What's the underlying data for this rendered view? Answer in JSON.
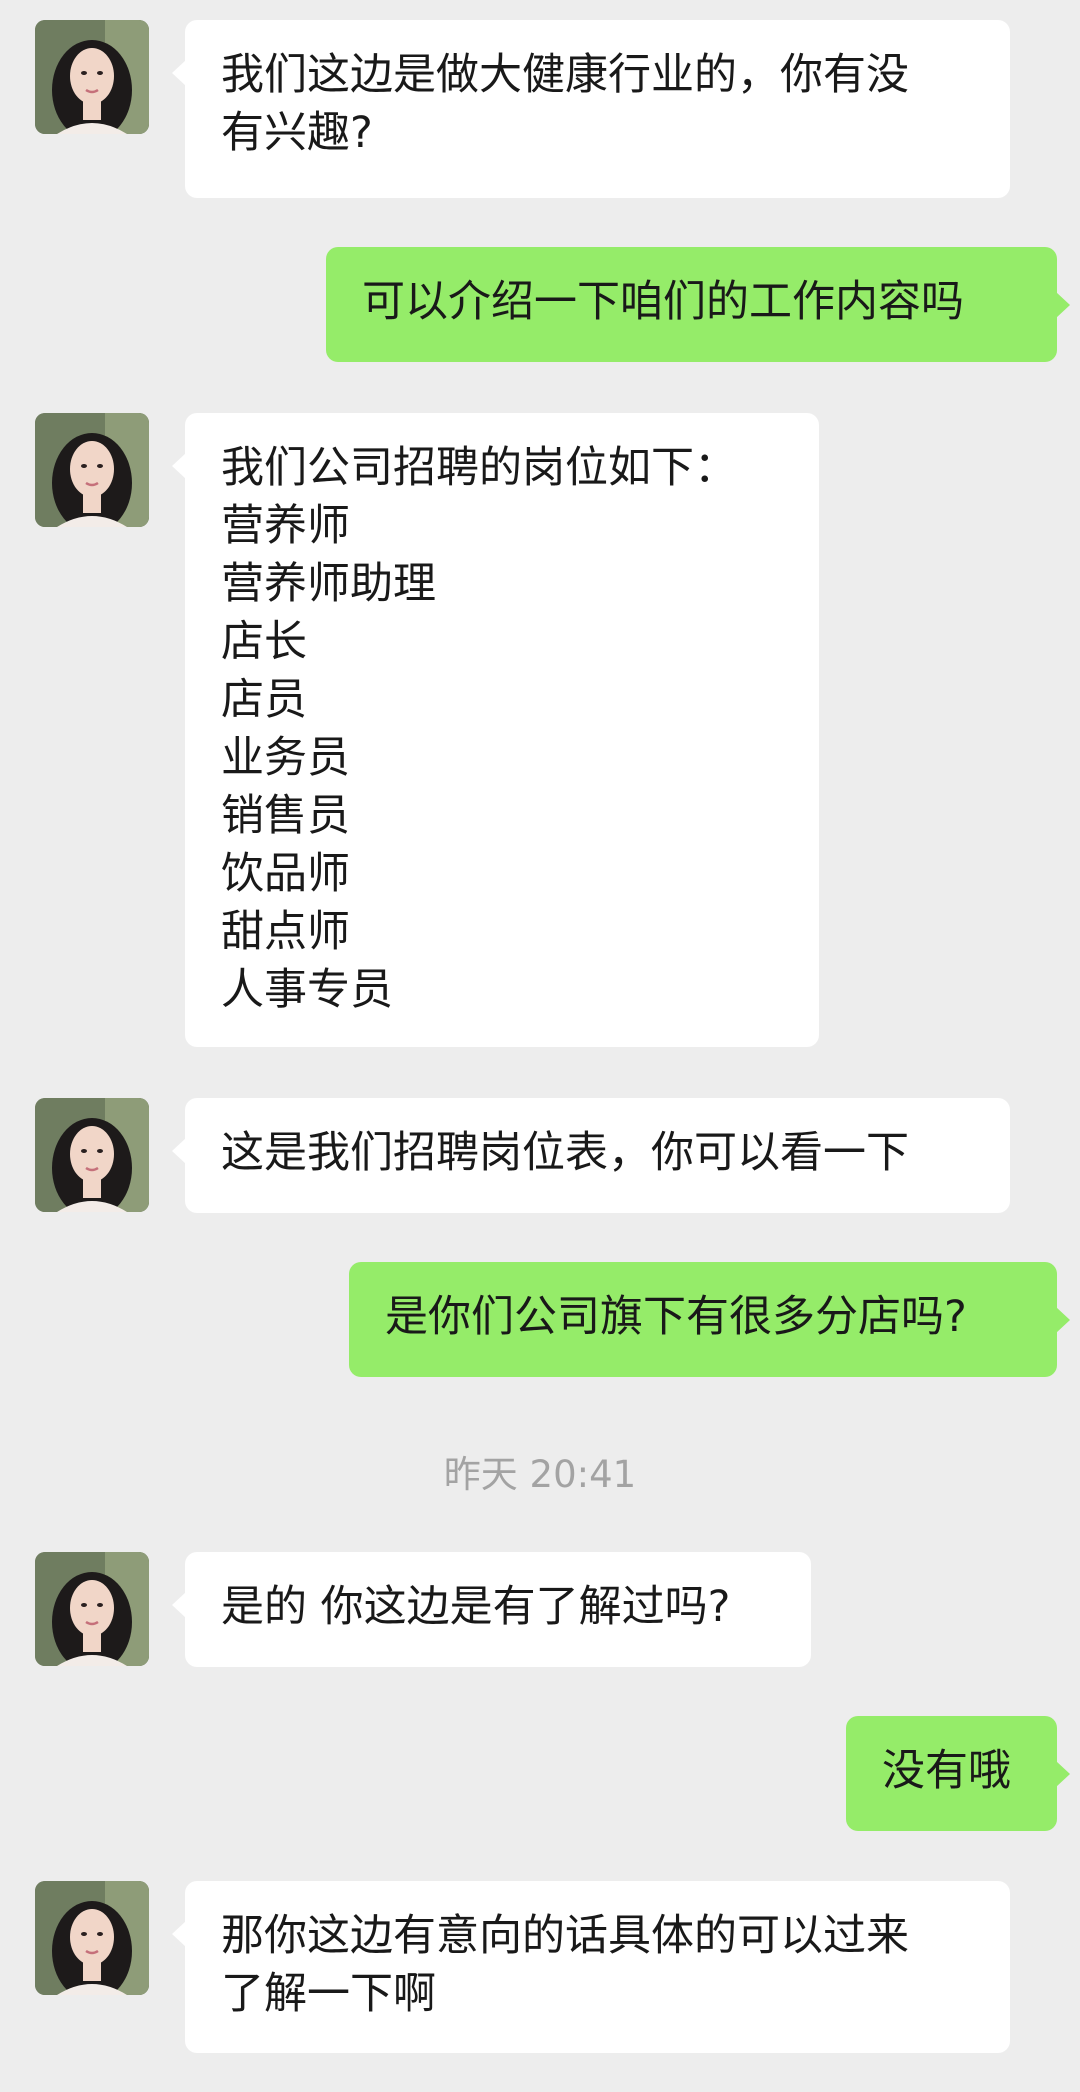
{
  "messages": [
    {
      "side": "in",
      "text": "我们这边是做大健康行业的，你有没\n有兴趣?"
    },
    {
      "side": "out",
      "text": "可以介绍一下咱们的工作内容吗"
    },
    {
      "side": "in",
      "text": "我们公司招聘的岗位如下：\n营养师\n营养师助理\n店长\n店员\n业务员\n销售员\n饮品师\n甜点师\n人事专员"
    },
    {
      "side": "in",
      "text": "这是我们招聘岗位表，你可以看一下"
    },
    {
      "side": "out",
      "text": "是你们公司旗下有很多分店吗?"
    },
    {
      "side": "in",
      "text": "是的 你这边是有了解过吗?"
    },
    {
      "side": "out",
      "text": "没有哦"
    },
    {
      "side": "in",
      "text": "那你这边有意向的话具体的可以过来\n了解一下啊"
    }
  ],
  "timestamp": "昨天 20:41",
  "colors": {
    "background": "#ededed",
    "incoming_bubble": "#ffffff",
    "outgoing_bubble": "#95ec69",
    "timestamp_text": "#a3a3a3"
  },
  "icons": {
    "contact_avatar": "contact-avatar-photo"
  }
}
